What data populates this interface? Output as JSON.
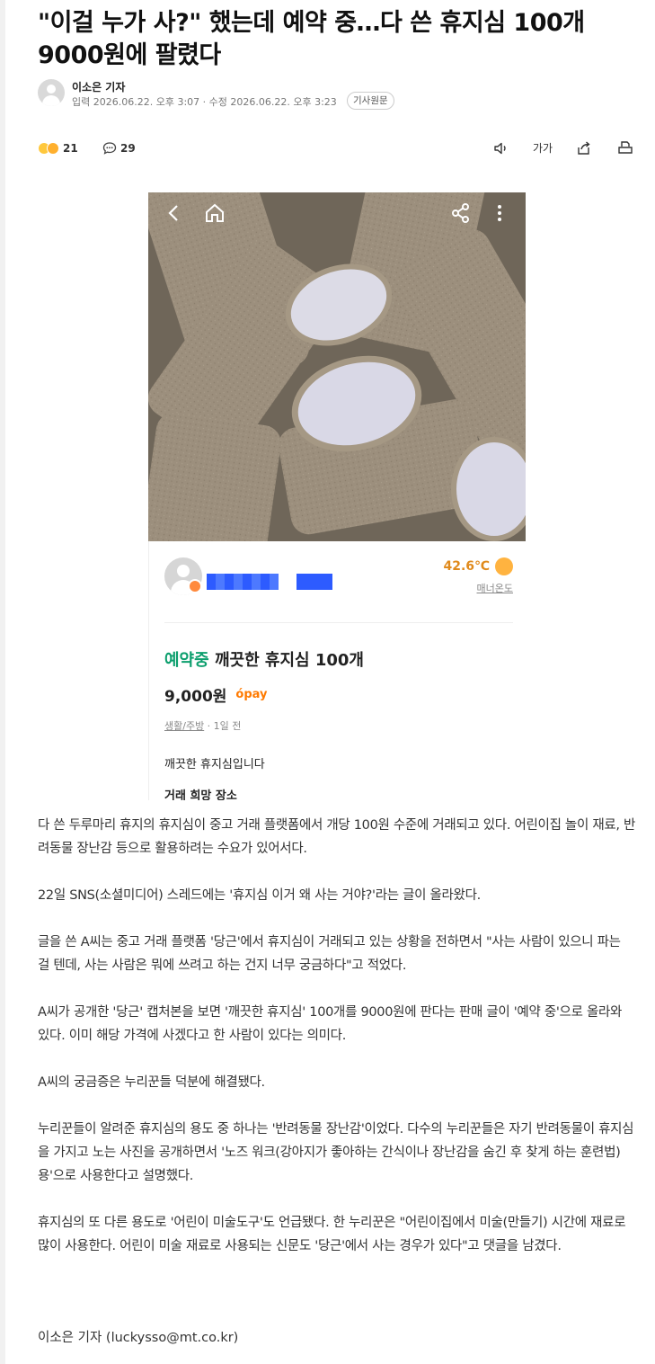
{
  "article": {
    "title": "\"이걸 누가 사?\" 했는데 예약 중…다 쓴 휴지심 100개 9000원에 팔렸다",
    "reporter": "이소은 기자",
    "dates": "입력 2026.06.22. 오후 3:07 · 수정 2026.06.22. 오후 3:23",
    "original_button": "기사원문",
    "reactions_count": "21",
    "comments_count": "29",
    "fontsize_label": "가가",
    "paragraphs": [
      "다 쓴 두루마리 휴지의 휴지심이 중고 거래 플랫폼에서 개당 100원 수준에 거래되고 있다. 어린이집 놀이 재료, 반려동물 장난감 등으로 활용하려는 수요가 있어서다.",
      "22일 SNS(소셜미디어) 스레드에는 '휴지심 이거 왜 사는 거야?'라는 글이 올라왔다.",
      "글을 쓴 A씨는 중고 거래 플랫폼 '당근'에서 휴지심이 거래되고 있는 상황을 전하면서 \"사는 사람이 있으니 파는 걸 텐데, 사는 사람은 뭐에 쓰려고 하는 건지 너무 궁금하다\"고 적었다.",
      "A씨가 공개한 '당근' 캡처본을 보면 '깨끗한 휴지심' 100개를 9000원에 판다는 판매 글이 '예약 중'으로 올라와 있다. 이미 해당 가격에 사겠다고 한 사람이 있다는 의미다.",
      "A씨의 궁금증은 누리꾼들 덕분에 해결됐다.",
      "누리꾼들이 알려준 휴지심의 용도 중 하나는 '반려동물 장난감'이었다. 다수의 누리꾼들은 자기 반려동물이 휴지심을 가지고 노는 사진을 공개하면서 '노즈 워크(강아지가 좋아하는 간식이나 장난감을 숨긴 후 찾게 하는 훈련법)용'으로 사용한다고 설명했다.",
      "휴지심의 또 다른 용도로 '어린이 미술도구'도 언급됐다. 한 누리꾼은 \"어린이집에서 미술(만들기) 시간에 재료로 많이 사용한다. 어린이 미술 재료로 사용되는 신문도 '당근'에서 사는 경우가 있다\"고 댓글을 남겼다."
    ],
    "signature": "이소은 기자 (luckysso@mt.co.kr)"
  },
  "listing": {
    "temperature": "42.6℃",
    "manner_label": "매너온도",
    "status": "예약중",
    "title": "깨끗한 휴지심 100개",
    "price": "9,000원",
    "pay_label": "pay",
    "category": "생활/주방",
    "time_ago": " · 1일 전",
    "description": "깨끗한 휴지심입니다",
    "place_label": "거래 희망 장소"
  },
  "colors": {
    "status_green": "#0d9f6e",
    "temp_orange": "#e08a1c",
    "pay_orange": "#ff7a00"
  }
}
